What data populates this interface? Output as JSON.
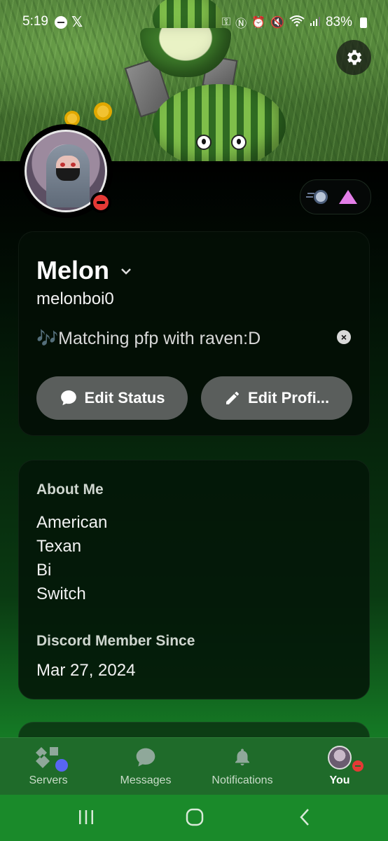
{
  "status_bar": {
    "time": "5:19",
    "battery": "83%",
    "icons": [
      "dnd-icon",
      "x-logo-icon",
      "key-icon",
      "nfc-icon",
      "alarm-icon",
      "mute-icon",
      "wifi-icon",
      "signal-icon",
      "battery-icon"
    ]
  },
  "profile": {
    "display_name": "Melon",
    "username": "melonboi0",
    "custom_status_emoji": "🎶",
    "custom_status": "Matching pfp with raven:D",
    "presence": "do-not-disturb"
  },
  "actions": {
    "edit_status": "Edit Status",
    "edit_profile": "Edit Profi..."
  },
  "about": {
    "heading": "About Me",
    "lines": [
      "American",
      "Texan",
      "Bi",
      "Switch"
    ],
    "member_since_heading": "Discord Member Since",
    "member_since": "Mar 27, 2024"
  },
  "bottom_nav": {
    "servers": "Servers",
    "messages": "Messages",
    "notifications": "Notifications",
    "you": "You",
    "active": "You"
  },
  "colors": {
    "accent_blue": "#5865f2",
    "dnd_red": "#e53935",
    "nitro_pink": "#e37ee8",
    "nav_green": "#1f6b2a"
  }
}
